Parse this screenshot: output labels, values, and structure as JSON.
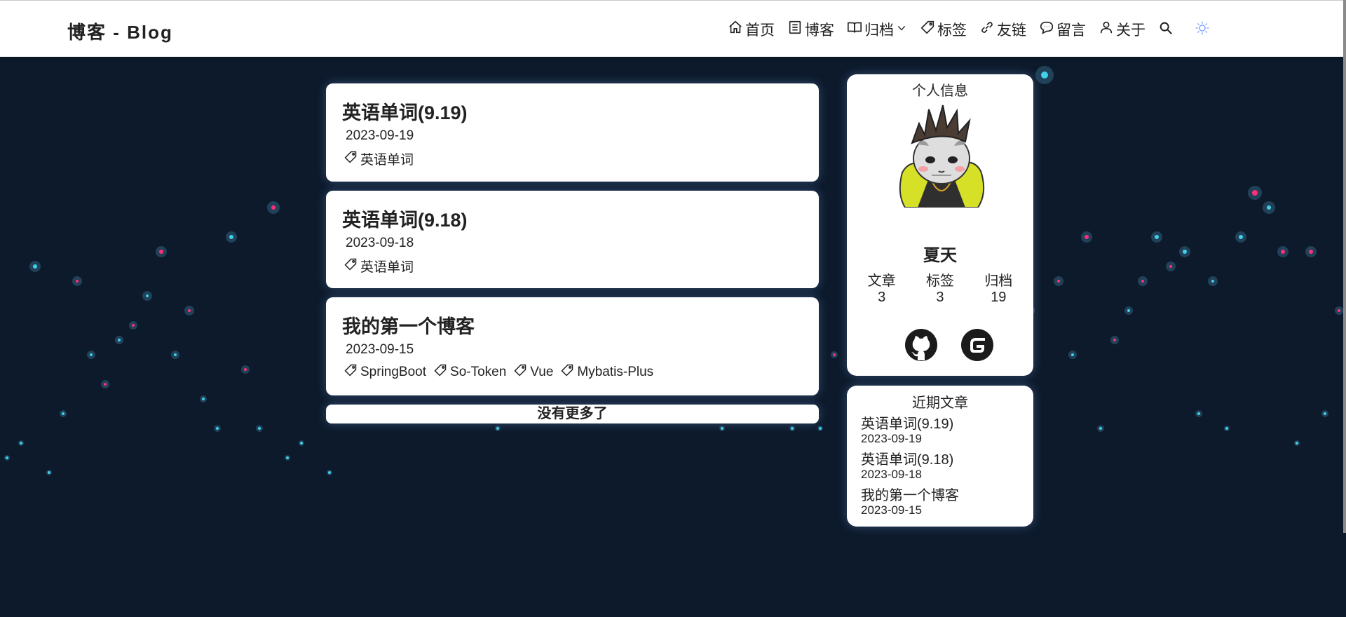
{
  "header": {
    "brand": "博客 - Blog",
    "nav": [
      {
        "label": "首页",
        "icon": "home-icon"
      },
      {
        "label": "博客",
        "icon": "list-icon"
      },
      {
        "label": "归档",
        "icon": "book-icon",
        "dropdown": true
      },
      {
        "label": "标签",
        "icon": "tag-icon"
      },
      {
        "label": "友链",
        "icon": "link-icon"
      },
      {
        "label": "留言",
        "icon": "comment-icon"
      },
      {
        "label": "关于",
        "icon": "user-icon"
      }
    ],
    "search_icon": "search-icon",
    "theme_icon": "sun-icon"
  },
  "posts": [
    {
      "title": "英语单词(9.19)",
      "date": "2023-09-19",
      "tags": [
        "英语单词"
      ]
    },
    {
      "title": "英语单词(9.18)",
      "date": "2023-09-18",
      "tags": [
        "英语单词"
      ]
    },
    {
      "title": "我的第一个博客",
      "date": "2023-09-15",
      "tags": [
        "SpringBoot",
        "So-Token",
        "Vue",
        "Mybatis-Plus"
      ]
    }
  ],
  "no_more": "没有更多了",
  "profile": {
    "section_title": "个人信息",
    "name": "夏天",
    "stats": [
      {
        "label": "文章",
        "value": "3"
      },
      {
        "label": "标签",
        "value": "3"
      },
      {
        "label": "归档",
        "value": "19"
      }
    ],
    "socials": [
      "github-icon",
      "gitee-icon"
    ]
  },
  "recent": {
    "section_title": "近期文章",
    "items": [
      {
        "title": "英语单词(9.19)",
        "date": "2023-09-19"
      },
      {
        "title": "英语单词(9.18)",
        "date": "2023-09-18"
      },
      {
        "title": "我的第一个博客",
        "date": "2023-09-15"
      }
    ]
  },
  "colors": {
    "background": "#0d1a2c",
    "card": "#ffffff",
    "dot_cyan": "#3fd0ea",
    "dot_pink": "#ff2e7a"
  }
}
